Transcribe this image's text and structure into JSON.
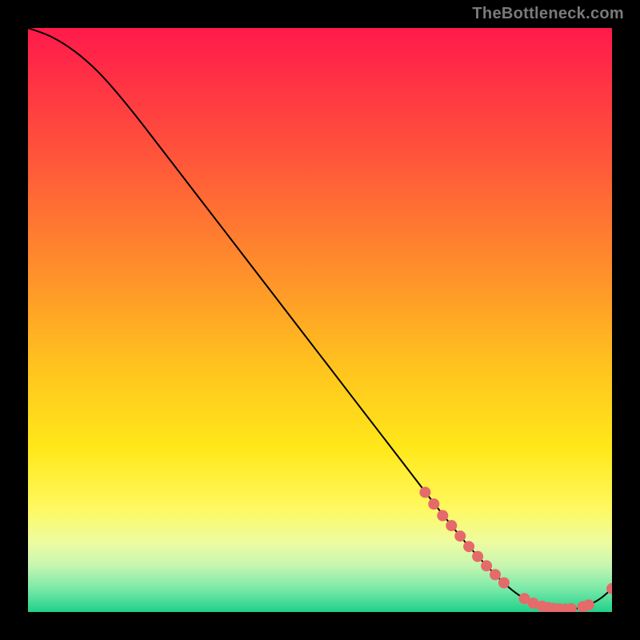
{
  "watermark": "TheBottleneck.com",
  "chart_data": {
    "type": "line",
    "title": "",
    "xlabel": "",
    "ylabel": "",
    "xlim": [
      0,
      100
    ],
    "ylim": [
      0,
      100
    ],
    "grid": false,
    "legend": false,
    "background_gradient": {
      "stops": [
        {
          "offset": 0.0,
          "color": "#ff1a4b"
        },
        {
          "offset": 0.2,
          "color": "#ff4f3c"
        },
        {
          "offset": 0.4,
          "color": "#ff8a2c"
        },
        {
          "offset": 0.58,
          "color": "#ffc31e"
        },
        {
          "offset": 0.72,
          "color": "#ffe81a"
        },
        {
          "offset": 0.82,
          "color": "#fff85e"
        },
        {
          "offset": 0.88,
          "color": "#eefca0"
        },
        {
          "offset": 0.92,
          "color": "#c7f6b1"
        },
        {
          "offset": 0.96,
          "color": "#7ae9a8"
        },
        {
          "offset": 1.0,
          "color": "#1fd18a"
        }
      ]
    },
    "series": [
      {
        "name": "bottleneck-curve",
        "color": "#000000",
        "x": [
          0,
          4,
          8,
          12,
          16,
          20,
          25,
          30,
          35,
          40,
          45,
          50,
          55,
          60,
          65,
          70,
          74,
          78,
          82,
          85,
          88,
          90,
          92,
          94,
          96,
          98,
          100
        ],
        "y": [
          100,
          98.5,
          96,
          92.5,
          88,
          83,
          76.5,
          70,
          63.5,
          57,
          50.5,
          44,
          37.5,
          31,
          24.5,
          18,
          13,
          8.5,
          4.5,
          2.3,
          1.0,
          0.6,
          0.5,
          0.6,
          1.2,
          2.3,
          4.0
        ]
      }
    ],
    "markers": {
      "name": "highlight-points",
      "color": "#e56a6a",
      "radius": 7,
      "points": [
        {
          "x": 68,
          "y": 20.5
        },
        {
          "x": 69.5,
          "y": 18.5
        },
        {
          "x": 71,
          "y": 16.5
        },
        {
          "x": 72.5,
          "y": 14.8
        },
        {
          "x": 74,
          "y": 13.0
        },
        {
          "x": 75.5,
          "y": 11.2
        },
        {
          "x": 77,
          "y": 9.5
        },
        {
          "x": 78.5,
          "y": 7.9
        },
        {
          "x": 80,
          "y": 6.4
        },
        {
          "x": 81.5,
          "y": 5.0
        },
        {
          "x": 85,
          "y": 2.3
        },
        {
          "x": 86.5,
          "y": 1.5
        },
        {
          "x": 88,
          "y": 1.0
        },
        {
          "x": 89,
          "y": 0.75
        },
        {
          "x": 90,
          "y": 0.6
        },
        {
          "x": 91,
          "y": 0.55
        },
        {
          "x": 92,
          "y": 0.5
        },
        {
          "x": 93,
          "y": 0.55
        },
        {
          "x": 95,
          "y": 0.9
        },
        {
          "x": 96,
          "y": 1.2
        },
        {
          "x": 100,
          "y": 4.0
        }
      ]
    }
  }
}
